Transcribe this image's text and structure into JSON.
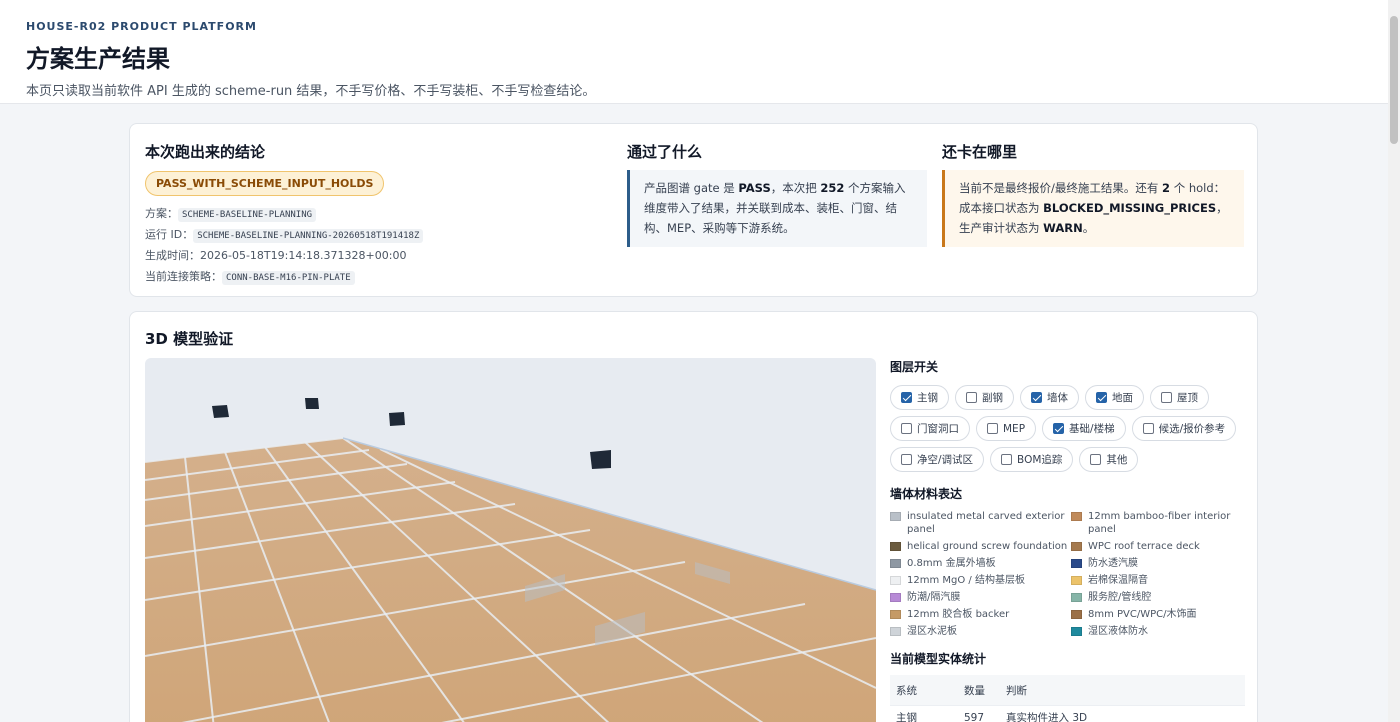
{
  "header": {
    "eyebrow": "HOUSE-R02 PRODUCT PLATFORM",
    "title": "方案生产结果",
    "subtitle": "本页只读取当前软件 API 生成的 scheme-run 结果，不手写价格、不手写装柜、不手写检查结论。"
  },
  "summary": {
    "title": "本次跑出来的结论",
    "badge": "PASS_WITH_SCHEME_INPUT_HOLDS",
    "scheme_label": "方案：",
    "scheme_value": "SCHEME-BASELINE-PLANNING",
    "run_label": "运行 ID：",
    "run_value": "SCHEME-BASELINE-PLANNING-20260518T191418Z",
    "time_label": "生成时间：",
    "time_value": "2026-05-18T19:14:18.371328+00:00",
    "strategy_label": "当前连接策略：",
    "strategy_value": "CONN-BASE-M16-PIN-PLATE"
  },
  "passed": {
    "title": "通过了什么",
    "t1": "产品图谱 gate 是 ",
    "b1": "PASS",
    "t2": "，本次把 ",
    "b2": "252",
    "t3": " 个方案输入维度带入了结果，并关联到成本、装柜、门窗、结构、MEP、采购等下游系统。"
  },
  "holds": {
    "title": "还卡在哪里",
    "t1": "当前不是最终报价/最终施工结果。还有 ",
    "b1": "2",
    "t2": " 个 hold：成本接口状态为 ",
    "b2": "BLOCKED_MISSING_PRICES",
    "t3": "，生产审计状态为 ",
    "b3": "WARN",
    "t4": "。"
  },
  "model": {
    "title": "3D 模型验证",
    "layers_title": "图层开关",
    "layers": [
      {
        "label": "主钢",
        "checked": true
      },
      {
        "label": "副钢",
        "checked": false
      },
      {
        "label": "墙体",
        "checked": true
      },
      {
        "label": "地面",
        "checked": true
      },
      {
        "label": "屋顶",
        "checked": false
      },
      {
        "label": "门窗洞口",
        "checked": false
      },
      {
        "label": "MEP",
        "checked": false
      },
      {
        "label": "基础/楼梯",
        "checked": true
      },
      {
        "label": "候选/报价参考",
        "checked": false
      },
      {
        "label": "净空/调试区",
        "checked": false
      },
      {
        "label": "BOM追踪",
        "checked": false
      },
      {
        "label": "其他",
        "checked": false
      }
    ],
    "materials_title": "墙体材料表达",
    "materials": [
      {
        "label": "insulated metal carved exterior panel",
        "color": "#b9c0c8"
      },
      {
        "label": "12mm bamboo-fiber interior panel",
        "color": "#c08a5a"
      },
      {
        "label": "helical ground screw foundation",
        "color": "#6b5b3e"
      },
      {
        "label": "WPC roof terrace deck",
        "color": "#a57a4e"
      },
      {
        "label": "0.8mm 金属外墙板",
        "color": "#8e98a3"
      },
      {
        "label": "防水透汽膜",
        "color": "#2a4a8a"
      },
      {
        "label": "12mm MgO / 结构基层板",
        "color": "#eef0f2"
      },
      {
        "label": "岩棉保温隔音",
        "color": "#ecc36a"
      },
      {
        "label": "防潮/隔汽膜",
        "color": "#b78ad6"
      },
      {
        "label": "服务腔/管线腔",
        "color": "#86b5a8"
      },
      {
        "label": "12mm 胶合板 backer",
        "color": "#c59a66"
      },
      {
        "label": "8mm PVC/WPC/木饰面",
        "color": "#9b7047"
      },
      {
        "label": "湿区水泥板",
        "color": "#cfd4d9"
      },
      {
        "label": "湿区液体防水",
        "color": "#1f8a9e"
      }
    ],
    "stats_title": "当前模型实体统计",
    "stats_headers": [
      "系统",
      "数量",
      "判断"
    ],
    "stats_rows": [
      [
        "主钢",
        "597",
        "真实构件进入 3D"
      ]
    ]
  }
}
